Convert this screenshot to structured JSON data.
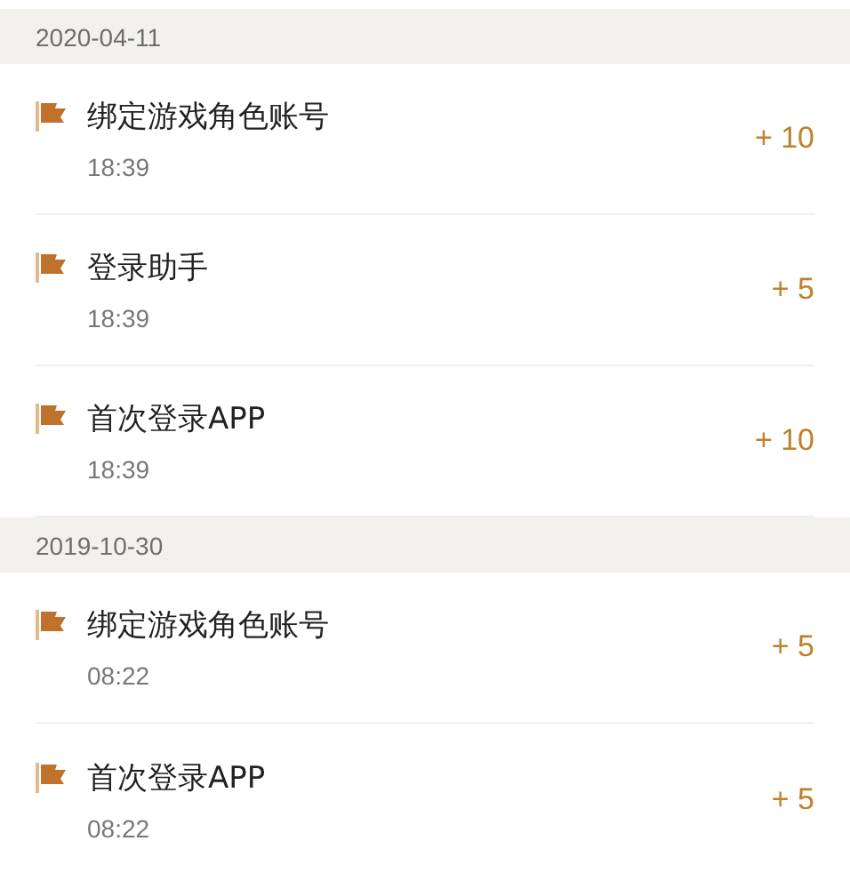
{
  "sections": [
    {
      "date": "2020-04-11",
      "items": [
        {
          "title": "绑定游戏角色账号",
          "time": "18:39",
          "points": "+ 10"
        },
        {
          "title": "登录助手",
          "time": "18:39",
          "points": "+ 5"
        },
        {
          "title": "首次登录APP",
          "time": "18:39",
          "points": "+ 10"
        }
      ]
    },
    {
      "date": "2019-10-30",
      "items": [
        {
          "title": "绑定游戏角色账号",
          "time": "08:22",
          "points": "+ 5"
        },
        {
          "title": "首次登录APP",
          "time": "08:22",
          "points": "+ 5"
        }
      ]
    }
  ]
}
